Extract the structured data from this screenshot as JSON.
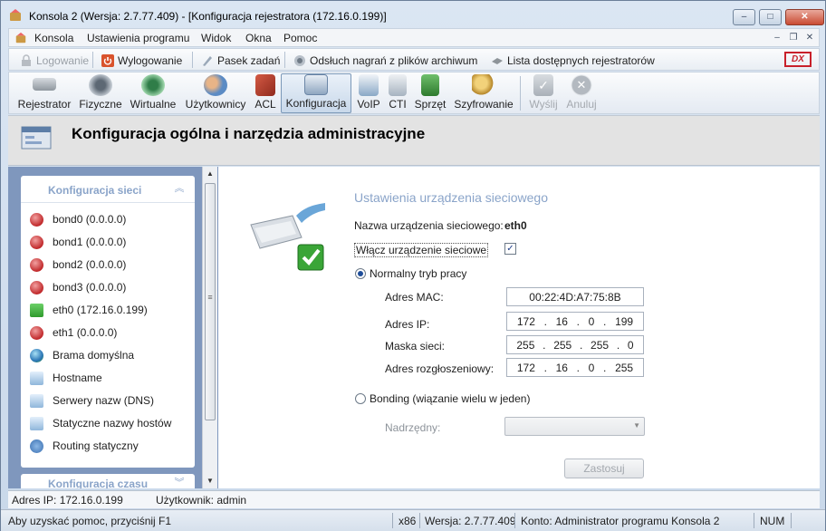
{
  "window": {
    "title": "Konsola 2 (Wersja:  2.7.77.409) - [Konfiguracja rejestratora (172.16.0.199)]",
    "controls": {
      "minimize": "–",
      "maximize": "□",
      "close": "✕"
    }
  },
  "menu": {
    "items": [
      "Konsola",
      "Ustawienia programu",
      "Widok",
      "Okna",
      "Pomoc"
    ],
    "mdi": [
      "–",
      "❐",
      "✕"
    ]
  },
  "toolbar1": {
    "items": [
      {
        "label": "Logowanie",
        "icon": "lock-icon",
        "disabled": true
      },
      {
        "label": "Wylogowanie",
        "icon": "power-icon"
      },
      {
        "label": "Pasek zadań",
        "icon": "pen-icon"
      },
      {
        "label": "Odsłuch nagrań z plików archiwum",
        "icon": "speaker-icon"
      },
      {
        "label": "Lista dostępnych rejestratorów",
        "icon": "device-icon"
      }
    ],
    "brand": "DX"
  },
  "toolbar2": {
    "items": [
      {
        "label": "Rejestrator",
        "icon": "recorder-icon",
        "color": "#9aa3ad"
      },
      {
        "label": "Fizyczne",
        "icon": "speaker-icon",
        "color": "#7f8a96"
      },
      {
        "label": "Wirtualne",
        "icon": "speaker-green-icon",
        "color": "#3f9a58"
      },
      {
        "label": "Użytkownicy",
        "icon": "users-icon",
        "color": "#5b8bc4"
      },
      {
        "label": "ACL",
        "icon": "book-icon",
        "color": "#b83a2a"
      },
      {
        "label": "Konfiguracja",
        "icon": "config-icon",
        "color": "#7c98b8",
        "active": true
      },
      {
        "label": "VoIP",
        "icon": "voip-icon",
        "color": "#6f93b5"
      },
      {
        "label": "CTI",
        "icon": "cti-icon",
        "color": "#a6b3c0"
      },
      {
        "label": "Sprzęt",
        "icon": "hardware-icon",
        "color": "#3e8b3e"
      },
      {
        "label": "Szyfrowanie",
        "icon": "key-icon",
        "color": "#c79a2e"
      },
      {
        "label": "Wyślij",
        "icon": "check-icon",
        "color": "#b8bec5",
        "disabled": true
      },
      {
        "label": "Anuluj",
        "icon": "cancel-icon",
        "color": "#b8bec5",
        "disabled": true
      }
    ]
  },
  "header": {
    "title": "Konfiguracja ogólna i narzędzia administracyjne"
  },
  "sidebar": {
    "panel_title": "Konfiguracja sieci",
    "items": [
      {
        "label": "bond0 (0.0.0.0)",
        "status": "err"
      },
      {
        "label": "bond1 (0.0.0.0)",
        "status": "err"
      },
      {
        "label": "bond2 (0.0.0.0)",
        "status": "err"
      },
      {
        "label": "bond3 (0.0.0.0)",
        "status": "err"
      },
      {
        "label": "eth0 (172.16.0.199)",
        "status": "ok"
      },
      {
        "label": "eth1 (0.0.0.0)",
        "status": "err"
      },
      {
        "label": "Brama domyślna",
        "status": "globe"
      },
      {
        "label": "Hostname",
        "status": "doc"
      },
      {
        "label": "Serwery nazw (DNS)",
        "status": "doc"
      },
      {
        "label": "Statyczne nazwy hostów",
        "status": "doc"
      },
      {
        "label": "Routing statyczny",
        "status": "route"
      }
    ],
    "panel2_title": "Konfiguracja czasu"
  },
  "form": {
    "section_title": "Ustawienia urządzenia sieciowego",
    "device_label": "Nazwa urządzenia sieciowego:",
    "device_value": "eth0",
    "enable_label": "Włącz urządzenie sieciowe",
    "enable_checked": "✓",
    "normal_mode_label": "Normalny tryb pracy",
    "mac_label": "Adres MAC:",
    "mac_value": "00:22:4D:A7:75:8B",
    "ip_label": "Adres IP:",
    "ip": [
      "172",
      "16",
      "0",
      "199"
    ],
    "mask_label": "Maska sieci:",
    "mask": [
      "255",
      "255",
      "255",
      "0"
    ],
    "broadcast_label": "Adres rozgłoszeniowy:",
    "broadcast": [
      "172",
      "16",
      "0",
      "255"
    ],
    "bonding_label": "Bonding (wiązanie wielu w jeden)",
    "master_label": "Nadrzędny:",
    "apply_label": "Zastosuj"
  },
  "infobar": {
    "ip": "Adres IP: 172.16.0.199",
    "user": "Użytkownik: admin"
  },
  "statusbar": {
    "help": "Aby uzyskać pomoc, przyciśnij F1",
    "arch": "x86",
    "version": "Wersja: 2.7.77.409",
    "account": "Konto: Administrator programu Konsola 2",
    "num": "NUM"
  },
  "colors": {
    "accent": "#8aa4c9",
    "sidebar_bg": "#7f97bd",
    "error": "#c0282a",
    "ok": "#2f9a2c",
    "brand": "#c8202a"
  }
}
